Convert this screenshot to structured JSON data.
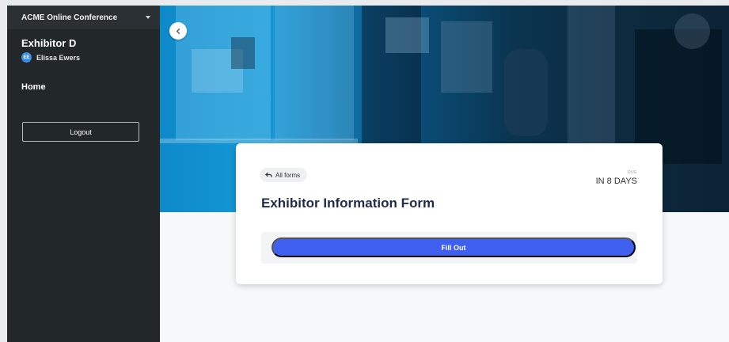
{
  "sidebar": {
    "conference_name": "ACME Online Conference",
    "exhibitor_name": "Exhibitor D",
    "user": {
      "initials": "EE",
      "name": "Elissa Ewers"
    },
    "home_label": "Home",
    "logout_label": "Logout"
  },
  "form_card": {
    "back_link_label": "All forms",
    "due_label": "DUE",
    "due_value": "IN 8 DAYS",
    "title": "Exhibitor Information Form",
    "fill_out_label": "Fill Out"
  },
  "colors": {
    "sidebar_bg": "#22272a",
    "primary_button": "#3f5ff0",
    "title_text": "#1f2b4a",
    "avatar_bg": "#3a8ee6"
  },
  "icons": {
    "sidebar_menu": "chevron-down-icon",
    "hero_back": "chevron-left-icon",
    "all_forms_back": "arrow-back-icon"
  }
}
